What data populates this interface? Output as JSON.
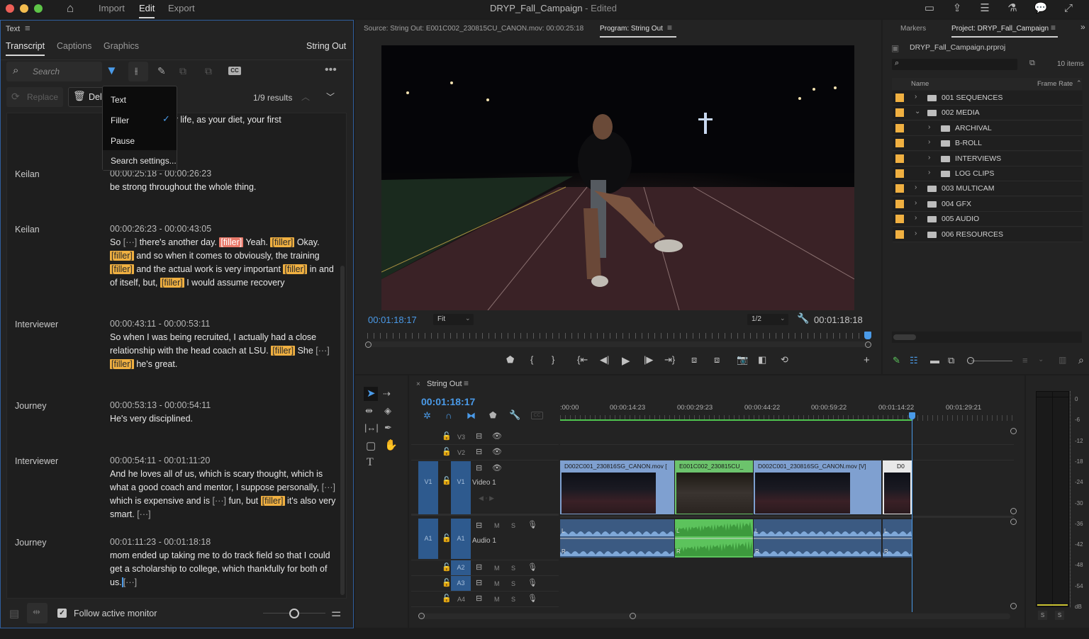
{
  "titlebar": {
    "title": "DRYP_Fall_Campaign",
    "title_status": " - Edited",
    "menu": [
      "Import",
      "Edit",
      "Export"
    ],
    "active_menu": "Edit"
  },
  "text_panel": {
    "header": "Text",
    "tabs": [
      "Transcript",
      "Captions",
      "Graphics"
    ],
    "active_tab": "Transcript",
    "sequence_name": "String Out",
    "search_placeholder": "Search",
    "replace_label": "Replace",
    "delete_label": "Dele",
    "results": "1/9 results",
    "filter_menu": {
      "items": [
        {
          "label": "Text",
          "checked": false
        },
        {
          "label": "Filler",
          "checked": true
        },
        {
          "label": "Pause",
          "checked": false
        }
      ],
      "settings": "Search settings..."
    },
    "segments": [
      {
        "speaker": "",
        "timecode": "",
        "lines": [
          "of rely on as your life, as your diet, your first"
        ]
      },
      {
        "speaker": "Keilan",
        "timecode": "00:00:25:18 - 00:00:26:23",
        "lines": [
          "be strong throughout the whole thing."
        ]
      },
      {
        "speaker": "Keilan",
        "timecode": "00:00:26:23 - 00:00:43:05"
      },
      {
        "speaker": "Interviewer",
        "timecode": "00:00:43:11 - 00:00:53:11"
      },
      {
        "speaker": "Journey",
        "timecode": "00:00:53:13 - 00:00:54:11",
        "lines": [
          "He's very disciplined."
        ]
      },
      {
        "speaker": "Interviewer",
        "timecode": "00:00:54:11 - 00:01:11:20"
      },
      {
        "speaker": "Journey",
        "timecode": "00:01:11:23 - 00:01:18:18"
      }
    ],
    "seg2_text": {
      "w1": "So",
      "e1": "[···]",
      "w2": " there's another day. ",
      "f1": "[filler]",
      "w3": " Yeah. ",
      "f2": "[filler]",
      "w4": " Okay. ",
      "f3": "[filler]",
      "w5": " and so when it comes to obviously, the training ",
      "f4": "[filler]",
      "w6": " and the actual work is very important ",
      "f5": "[filler]",
      "w7": " in and of itself, but, ",
      "f6": "[filler]",
      "w8": " I would assume recovery"
    },
    "seg3_text": {
      "w1": "So when I was being recruited, I actually had a close relationship with the head coach at LSU. ",
      "f1": "[filler]",
      "w2": " She ",
      "e1": "[···]",
      "w3": " ",
      "f2": "[filler]",
      "w4": " he's great."
    },
    "seg5_text": {
      "w1": "And he loves all of us, which is scary thought, which is what a good coach and mentor, I suppose personally, ",
      "e1": "[···]",
      "w2": " which is expensive and is ",
      "e2": "[···]",
      "w3": " fun, but ",
      "f1": "[filler]",
      "w4": " it's also very smart. ",
      "e3": "[···]"
    },
    "seg6_text": {
      "w1": "mom ended up taking me to do track field so that I could get a scholarship to college, which thankfully for both of us.",
      "e1": "[···]"
    },
    "follow_label": "Follow active monitor",
    "follow_checked": true
  },
  "monitor": {
    "source_tab": "Source: String Out: E001C002_230815CU_CANON.mov: 00:00:25:18",
    "program_tab": "Program: String Out",
    "current_tc": "00:01:18:17",
    "zoom": "Fit",
    "resolution": "1/2",
    "duration_tc": "00:01:18:18"
  },
  "project": {
    "tabs": [
      "Markers",
      "Project: DRYP_Fall_Campaign"
    ],
    "active_tab": "Project: DRYP_Fall_Campaign",
    "file": "DRYP_Fall_Campaign.prproj",
    "item_count": "10 items",
    "col_name": "Name",
    "col_framerate": "Frame Rate",
    "rows": [
      {
        "name": "001 SEQUENCES",
        "level": 0,
        "expanded": false
      },
      {
        "name": "002 MEDIA",
        "level": 0,
        "expanded": true
      },
      {
        "name": "ARCHIVAL",
        "level": 1,
        "expanded": false
      },
      {
        "name": "B-ROLL",
        "level": 1,
        "expanded": false
      },
      {
        "name": "INTERVIEWS",
        "level": 1,
        "expanded": false
      },
      {
        "name": "LOG CLIPS",
        "level": 1,
        "expanded": false
      },
      {
        "name": "003 MULTICAM",
        "level": 0,
        "expanded": false
      },
      {
        "name": "004 GFX",
        "level": 0,
        "expanded": false
      },
      {
        "name": "005 AUDIO",
        "level": 0,
        "expanded": false
      },
      {
        "name": "006 RESOURCES",
        "level": 0,
        "expanded": false
      }
    ],
    "swatch_color": "#f0b041"
  },
  "timeline": {
    "sequence": "String Out",
    "current_tc": "00:01:18:17",
    "ruler": [
      ":00:00",
      "00:00:14:23",
      "00:00:29:23",
      "00:00:44:22",
      "00:00:59:22",
      "00:01:14:22",
      "00:01:29:21"
    ],
    "tracks": {
      "v3": "V3",
      "v2": "V2",
      "v1": "V1",
      "video1": "Video 1",
      "a1": "A1",
      "audio1": "Audio 1",
      "a2": "A2",
      "a3": "A3",
      "a4": "A4",
      "m": "M",
      "s": "S"
    },
    "clips": [
      {
        "name": "D002C001_230816SG_CANON.mov [",
        "color": "#7fa0d0"
      },
      {
        "name": "E001C002_230815CU_",
        "color": "#6cc36c"
      },
      {
        "name": "D002C001_230816SG_CANON.mov [V]",
        "color": "#7fa0d0"
      },
      {
        "name": "D0",
        "color": "#e8e8e8"
      }
    ],
    "audio_channels": [
      "L",
      "R"
    ]
  },
  "meters": {
    "scale": [
      "0",
      "-6",
      "-12",
      "-18",
      "-24",
      "-30",
      "-36",
      "-42",
      "-48",
      "-54",
      "dB"
    ],
    "solo": [
      "S",
      "S"
    ]
  },
  "colors": {
    "accent_blue": "#4a9ae8",
    "filler": "#f0b041",
    "filler_selected": "#e87a6b",
    "panel_border": "#2f5e9e"
  }
}
